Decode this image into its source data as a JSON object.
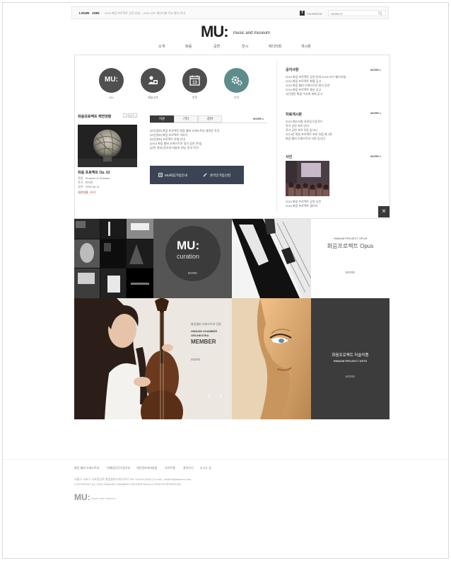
{
  "topbar": {
    "login": "LOGIN",
    "join": "JOIN",
    "notice": "2015 화음 프로젝트 공연 안내 – 2015 HPF 페스티벌 주요 행사 안내",
    "facebook": "FACEBOOK",
    "search_placeholder": "SEARCH"
  },
  "logo": {
    "mark": "MU:",
    "subtitle": "music and museum"
  },
  "gnb": [
    "소개",
    "화음",
    "공연",
    "전시",
    "에디터장",
    "게시판"
  ],
  "quick_menu": [
    {
      "label": "MU",
      "icon": "mu-logo-icon"
    },
    {
      "label": "예술교육",
      "icon": "people-icon"
    },
    {
      "label": "연혁",
      "icon": "calendar-icon"
    },
    {
      "label": "조직",
      "icon": "gears-icon"
    }
  ],
  "project": {
    "title": "화음프로젝트 재연현황",
    "item_title": "화음 프로젝트 Op. 62",
    "details": [
      "작품 : Shadow of Shadow",
      "작가 : 한지민",
      "공연 : 2008.05.11"
    ],
    "status": "재연현황 : 보기"
  },
  "tabs": {
    "items": [
      "지원",
      "기타",
      "참여"
    ],
    "more": "MORE",
    "lines": [
      "[조선일보] 화음 프로젝트 화음 챔버 오케스트라 새로운 작곡",
      "[조선일보] 화음 프로젝트 이야기",
      "[조선일보] 프로젝트 연재 안내",
      "[2015 화음 챔버 오케스트라 정기 공연 안내]",
      "[공연 정보] 음악과 미술의 만남, 한국 작가"
    ]
  },
  "buttons": {
    "left": "MU화음가입안내",
    "right": "온라인가입신청"
  },
  "right": {
    "notice_title": "공지사항",
    "notice_lines": [
      "2015 화음 프로젝트 공연 안내 2015 HPF 페스티벌…",
      "2015 화음 프로젝트 채용 공고",
      "2015 화음 챔버 오케스트라 정기 공연",
      "2015 화음 프로젝트 결산 공고",
      "사단법인 화음 이사회 개최 공고"
    ],
    "data_title": "자료게시판",
    "data_lines": [
      "2015 페스티벌 자료집 다운로드",
      "작가 공연 자료 안내",
      "작가 공연 자료 모음 입니다",
      "2014년 화음 프로젝트 자료 모음 제 1편",
      "화음 챔버 오케스트라 자료 입니다"
    ],
    "photo_title": "사진",
    "photo_caption": "2015 화음 프로젝트 공연 사진",
    "photo_caption2": "2015 화음 프로젝트 갤러리",
    "more": "MORE"
  },
  "tiles": {
    "curation_mark": "MU:",
    "curation_word": "curation",
    "curation_more": "MORE",
    "opus_en": "HWAUM PROJECT OPUS",
    "opus_ko": "화음프로젝트 Opus",
    "opus_more": "MORE",
    "member_ko": "화음챔버 오케스트라 단원",
    "member_en1": "HWAUM CHAMBER",
    "member_en2": "ORCHESTRA",
    "member_en3": "MEMBER",
    "member_more": "MORE",
    "arts_ko": "화음프로젝트 미술작품",
    "arts_en": "HWAUM PROJECT ARTS",
    "arts_more": "MORE"
  },
  "footer": {
    "links": [
      "화음 챔버 오케스트라",
      "이메일무단수집거부",
      "개인정보처리방침",
      "사이트맵",
      "찾아오기",
      "오시는 길"
    ],
    "address": "서울시 서초구 서초중앙로 화음챔버오케스트라 TEL 02-544-2000 | E-mail : hwaum@hwaum.com",
    "copyright": "COPYRIGHT (C) 2015 HWAUM CHAMBER ORCHESTRA ALL RIGHTS RESERVED.",
    "logo_mark": "MU:",
    "logo_sub": "music and museum"
  },
  "colors": {
    "dark": "#3a3a3a",
    "circle": "#4f4f4f",
    "teal": "#5e8c8a",
    "navy": "#3b4354",
    "accent_red": "#c0392b"
  }
}
